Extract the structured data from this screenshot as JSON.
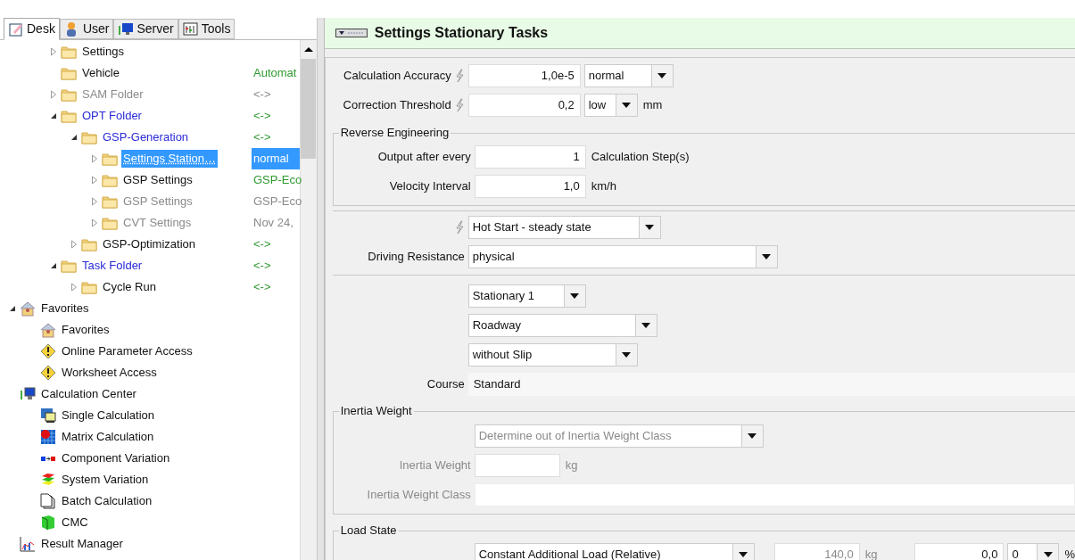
{
  "tabs": [
    {
      "label": "Desk",
      "selected": true,
      "kind": "desk"
    },
    {
      "label": "User",
      "selected": false,
      "kind": "user"
    },
    {
      "label": "Server",
      "selected": false,
      "kind": "server"
    },
    {
      "label": "Tools",
      "selected": false,
      "kind": "tools"
    }
  ],
  "tree": {
    "scrolled_items": [
      {
        "label": "Settings",
        "expanded": false,
        "kind": "folder"
      },
      {
        "label": "Vehicle",
        "value": "Automat",
        "kind": "folder"
      },
      {
        "label": "SAM Folder",
        "value": "<->",
        "expanded": false,
        "disabled": true,
        "kind": "folder"
      },
      {
        "label": "OPT Folder",
        "value": "<->",
        "expanded": true,
        "highlighted": true,
        "kind": "folder",
        "children": [
          {
            "label": "GSP-Generation",
            "value": "<->",
            "expanded": true,
            "highlighted": true,
            "kind": "folder",
            "children": [
              {
                "label": "Settings Station…",
                "value": "normal",
                "expanded": false,
                "selected": true,
                "kind": "folder"
              },
              {
                "label": "GSP Settings",
                "value": "GSP-Eco",
                "expanded": false,
                "selected": false,
                "kind": "folder"
              },
              {
                "label": "GSP Settings",
                "value": "GSP-Eco",
                "expanded": false,
                "selected": false,
                "disabled": true,
                "kind": "folder"
              },
              {
                "label": "CVT Settings",
                "value": "Nov 24,",
                "expanded": false,
                "selected": false,
                "disabled": true,
                "kind": "folder"
              }
            ]
          },
          {
            "label": "GSP-Optimization",
            "value": "<->",
            "expanded": false,
            "kind": "folder"
          }
        ]
      },
      {
        "label": "Task Folder",
        "value": "<->",
        "expanded": true,
        "highlighted": true,
        "kind": "folder",
        "children": [
          {
            "label": "Cycle Run",
            "value": "<->",
            "expanded": false,
            "kind": "folder"
          }
        ]
      }
    ],
    "items": [
      {
        "label": "Favorites",
        "expanded": true,
        "kind": "favorites",
        "children": [
          {
            "label": "Favorites",
            "kind": "favorites"
          },
          {
            "label": "Online Parameter Access",
            "kind": "warning"
          },
          {
            "label": "Worksheet Access",
            "kind": "warning"
          }
        ]
      },
      {
        "label": "Calculation Center",
        "kind": "center",
        "children": [
          {
            "label": "Single Calculation",
            "kind": "single"
          },
          {
            "label": "Matrix Calculation",
            "kind": "matrix"
          },
          {
            "label": "Component Variation",
            "kind": "component"
          },
          {
            "label": "System Variation",
            "kind": "system"
          },
          {
            "label": "Batch Calculation",
            "kind": "batch"
          },
          {
            "label": "CMC",
            "kind": "cmc"
          }
        ]
      },
      {
        "label": "Result Manager",
        "kind": "result"
      }
    ]
  },
  "header": {
    "title": "Settings Stationary Tasks"
  },
  "accuracy_rows": [
    {
      "label": "Calculation Accuracy",
      "value": "1,0e-5",
      "option": "normal"
    },
    {
      "label": "Correction Threshold",
      "value": "0,2",
      "option": "low",
      "unit": "mm"
    }
  ],
  "reverse_engineering": {
    "title": "Reverse Engineering",
    "rows": [
      {
        "label": "Output after every",
        "value": "1",
        "unit": "Calculation Step(s)"
      },
      {
        "label": "Velocity Interval",
        "value": "1,0",
        "unit": "km/h"
      }
    ]
  },
  "start": {
    "option": "Hot Start - steady state"
  },
  "driving_resistance": {
    "label": "Driving Resistance",
    "option": "physical"
  },
  "stationary_options": [
    "Stationary 1",
    "Roadway",
    "without Slip"
  ],
  "course": {
    "label": "Course",
    "value": "Standard"
  },
  "inertia_weight": {
    "title": "Inertia Weight",
    "option": "Determine out of Inertia Weight Class",
    "weight_label": "Inertia Weight",
    "unit": "kg",
    "class_label": "Inertia Weight Class",
    "disabled": true
  },
  "load_state": {
    "title": "Load State",
    "option": "Constant Additional Load (Relative)",
    "load_value": "140,0",
    "load_unit": "kg",
    "percent_value": "0,0",
    "percent_option": "0",
    "percent_unit": "%"
  }
}
